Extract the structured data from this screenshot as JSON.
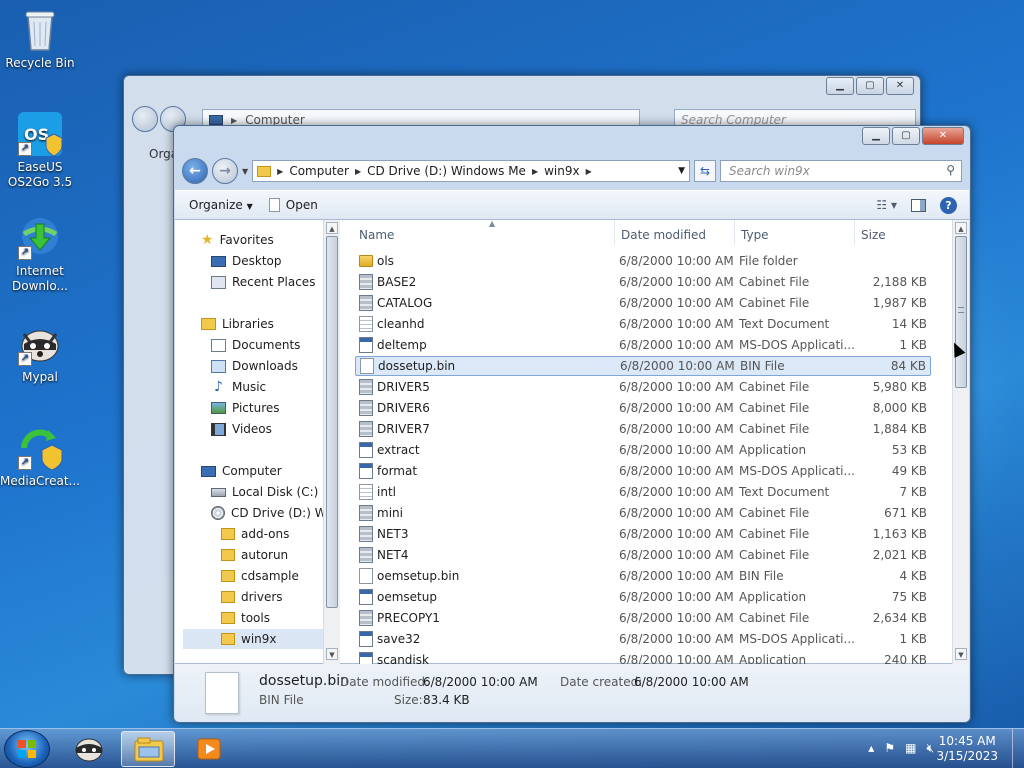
{
  "desktop": {
    "icons": [
      {
        "label": "Recycle Bin",
        "icon": "recycle-bin-icon"
      },
      {
        "label": "EaseUS\nOS2Go 3.5",
        "icon": "easeus-os2go-icon"
      },
      {
        "label": "Internet\nDownlo...",
        "icon": "internet-download-manager-icon"
      },
      {
        "label": "Mypal",
        "icon": "mypal-icon"
      },
      {
        "label": "MediaCreat...",
        "icon": "media-creation-tool-icon"
      }
    ]
  },
  "back_window": {
    "address": "Computer",
    "search_placeholder": "Search Computer",
    "toolbar_label": "Orga"
  },
  "window": {
    "address": {
      "segments": [
        "Computer",
        "CD Drive (D:) Windows Me",
        "win9x"
      ]
    },
    "search_placeholder": "Search win9x",
    "toolbar": {
      "organize": "Organize",
      "open": "Open"
    },
    "controls": {
      "minimize": "minimize",
      "maximize": "maximize",
      "close": "close"
    }
  },
  "nav": {
    "favorites": "Favorites",
    "desktop": "Desktop",
    "recent": "Recent Places",
    "libraries": "Libraries",
    "documents": "Documents",
    "downloads": "Downloads",
    "music": "Music",
    "pictures": "Pictures",
    "videos": "Videos",
    "computer": "Computer",
    "local_disk": "Local Disk (C:)",
    "cd_drive": "CD Drive (D:) Wir",
    "folders": [
      "add-ons",
      "autorun",
      "cdsample",
      "drivers",
      "tools",
      "win9x"
    ]
  },
  "columns": {
    "name": "Name",
    "date": "Date modified",
    "type": "Type",
    "size": "Size"
  },
  "files": [
    {
      "name": "ols",
      "date": "6/8/2000 10:00 AM",
      "type": "File folder",
      "size": "",
      "icon": "folder"
    },
    {
      "name": "BASE2",
      "date": "6/8/2000 10:00 AM",
      "type": "Cabinet File",
      "size": "2,188 KB",
      "icon": "cab"
    },
    {
      "name": "CATALOG",
      "date": "6/8/2000 10:00 AM",
      "type": "Cabinet File",
      "size": "1,987 KB",
      "icon": "cab"
    },
    {
      "name": "cleanhd",
      "date": "6/8/2000 10:00 AM",
      "type": "Text Document",
      "size": "14 KB",
      "icon": "txt"
    },
    {
      "name": "deltemp",
      "date": "6/8/2000 10:00 AM",
      "type": "MS-DOS Applicati...",
      "size": "1 KB",
      "icon": "exe"
    },
    {
      "name": "dossetup.bin",
      "date": "6/8/2000 10:00 AM",
      "type": "BIN File",
      "size": "84 KB",
      "icon": "bin"
    },
    {
      "name": "DRIVER5",
      "date": "6/8/2000 10:00 AM",
      "type": "Cabinet File",
      "size": "5,980 KB",
      "icon": "cab"
    },
    {
      "name": "DRIVER6",
      "date": "6/8/2000 10:00 AM",
      "type": "Cabinet File",
      "size": "8,000 KB",
      "icon": "cab"
    },
    {
      "name": "DRIVER7",
      "date": "6/8/2000 10:00 AM",
      "type": "Cabinet File",
      "size": "1,884 KB",
      "icon": "cab"
    },
    {
      "name": "extract",
      "date": "6/8/2000 10:00 AM",
      "type": "Application",
      "size": "53 KB",
      "icon": "exe"
    },
    {
      "name": "format",
      "date": "6/8/2000 10:00 AM",
      "type": "MS-DOS Applicati...",
      "size": "49 KB",
      "icon": "exe"
    },
    {
      "name": "intl",
      "date": "6/8/2000 10:00 AM",
      "type": "Text Document",
      "size": "7 KB",
      "icon": "txt"
    },
    {
      "name": "mini",
      "date": "6/8/2000 10:00 AM",
      "type": "Cabinet File",
      "size": "671 KB",
      "icon": "cab"
    },
    {
      "name": "NET3",
      "date": "6/8/2000 10:00 AM",
      "type": "Cabinet File",
      "size": "1,163 KB",
      "icon": "cab"
    },
    {
      "name": "NET4",
      "date": "6/8/2000 10:00 AM",
      "type": "Cabinet File",
      "size": "2,021 KB",
      "icon": "cab"
    },
    {
      "name": "oemsetup.bin",
      "date": "6/8/2000 10:00 AM",
      "type": "BIN File",
      "size": "4 KB",
      "icon": "bin"
    },
    {
      "name": "oemsetup",
      "date": "6/8/2000 10:00 AM",
      "type": "Application",
      "size": "75 KB",
      "icon": "exe"
    },
    {
      "name": "PRECOPY1",
      "date": "6/8/2000 10:00 AM",
      "type": "Cabinet File",
      "size": "2,634 KB",
      "icon": "cab"
    },
    {
      "name": "save32",
      "date": "6/8/2000 10:00 AM",
      "type": "MS-DOS Applicati...",
      "size": "1 KB",
      "icon": "exe"
    },
    {
      "name": "scandisk",
      "date": "6/8/2000 10:00 AM",
      "type": "Application",
      "size": "240 KB",
      "icon": "exe"
    }
  ],
  "selected_file": "dossetup.bin",
  "details": {
    "name": "dossetup.bin",
    "type": "BIN File",
    "date_modified_label": "Date modified:",
    "date_modified": "6/8/2000 10:00 AM",
    "date_created_label": "Date created:",
    "date_created": "6/8/2000 10:00 AM",
    "size_label": "Size:",
    "size": "83.4 KB"
  },
  "taskbar": {
    "time": "10:45 AM",
    "date": "3/15/2023",
    "pinned": [
      "mypal-icon",
      "windows-explorer-icon",
      "media-player-icon"
    ]
  },
  "colors": {
    "accent": "#3a78c8",
    "selection": "#dbe8f8",
    "selection_border": "#7fa6dc"
  }
}
